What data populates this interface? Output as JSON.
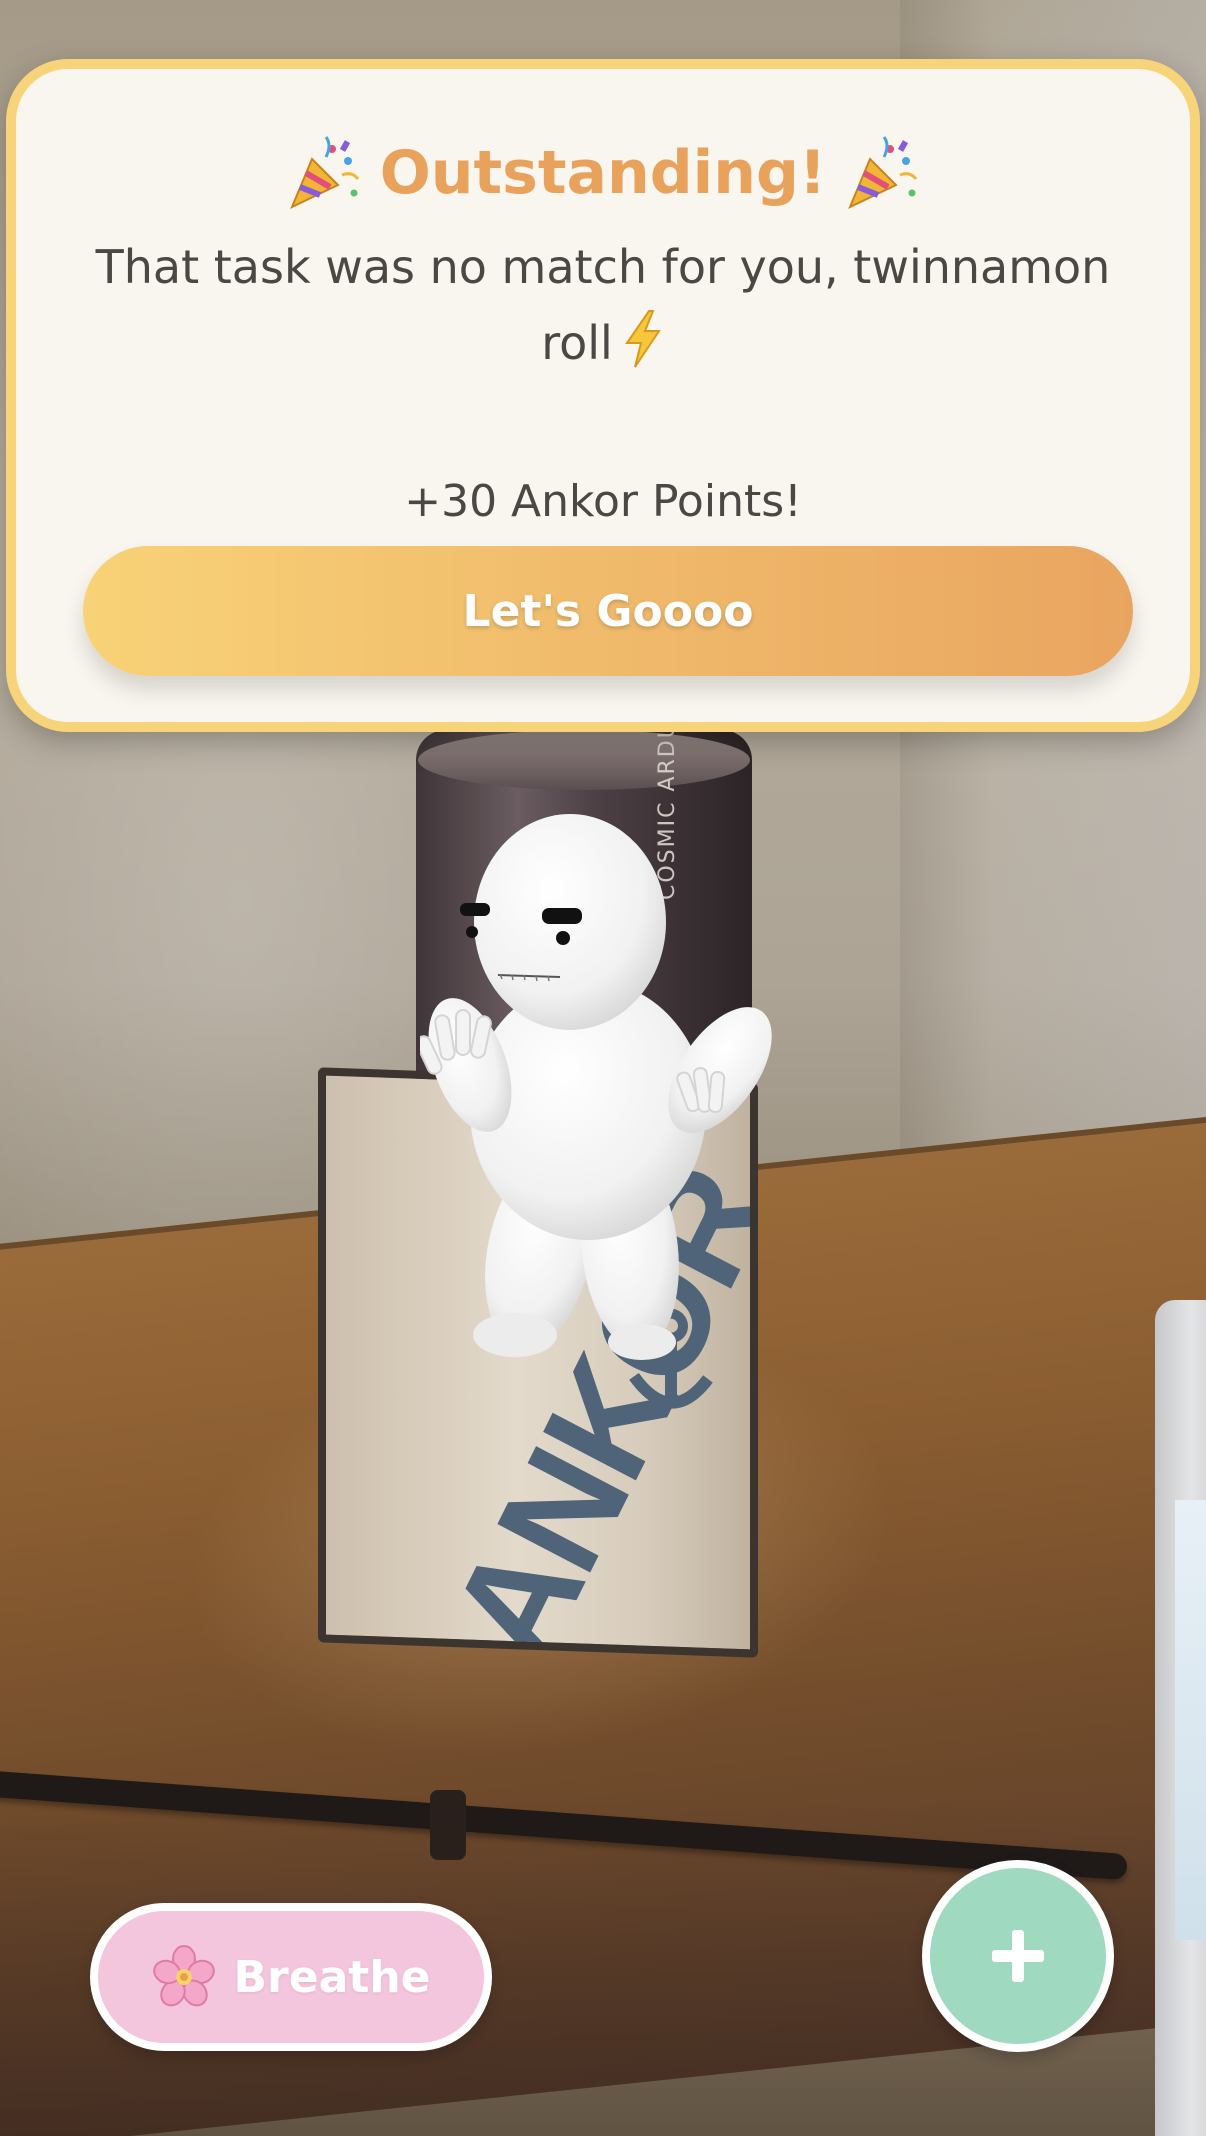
{
  "modal": {
    "title": "Outstanding!",
    "title_emoji": "party-popper-icon",
    "message": "That task was no match for you, twinnamon roll",
    "message_emoji": "lightning-bolt-icon",
    "points": "+30 Ankor Points!",
    "button_label": "Let's Goooo"
  },
  "controls": {
    "breathe_label": "Breathe",
    "breathe_icon": "cherry-blossom-icon",
    "add_icon": "plus-icon"
  },
  "scene": {
    "box_logo": "ANKOR",
    "can_text": "COSMIC ARDUS"
  },
  "colors": {
    "accent": "#e9a25c",
    "modal_border": "#f7d47a",
    "breathe_bg": "#f3c6dd",
    "add_bg": "#9fd9c0"
  }
}
